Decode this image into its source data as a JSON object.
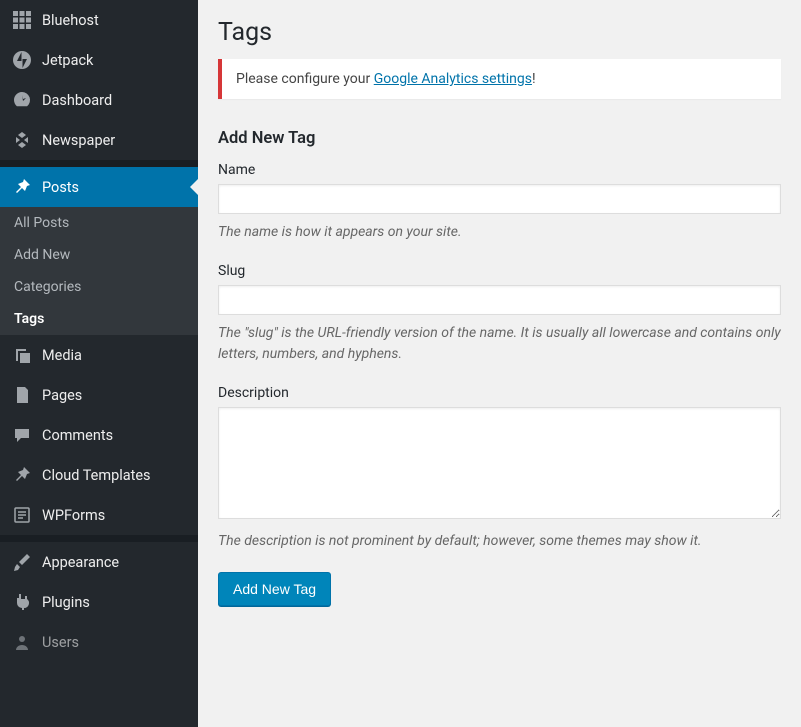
{
  "sidebar": {
    "bluehost": "Bluehost",
    "jetpack": "Jetpack",
    "dashboard": "Dashboard",
    "newspaper": "Newspaper",
    "posts": "Posts",
    "posts_sub": {
      "all": "All Posts",
      "add": "Add New",
      "categories": "Categories",
      "tags": "Tags"
    },
    "media": "Media",
    "pages": "Pages",
    "comments": "Comments",
    "cloud_templates": "Cloud Templates",
    "wpforms": "WPForms",
    "appearance": "Appearance",
    "plugins": "Plugins",
    "users": "Users"
  },
  "main": {
    "title": "Tags",
    "notice_pre": "Please configure your ",
    "notice_link": "Google Analytics settings",
    "notice_post": "!",
    "section_title": "Add New Tag",
    "name_label": "Name",
    "name_help": "The name is how it appears on your site.",
    "slug_label": "Slug",
    "slug_help": "The \"slug\" is the URL-friendly version of the name. It is usually all lowercase and contains only letters, numbers, and hyphens.",
    "desc_label": "Description",
    "desc_help": "The description is not prominent by default; however, some themes may show it.",
    "submit": "Add New Tag"
  }
}
